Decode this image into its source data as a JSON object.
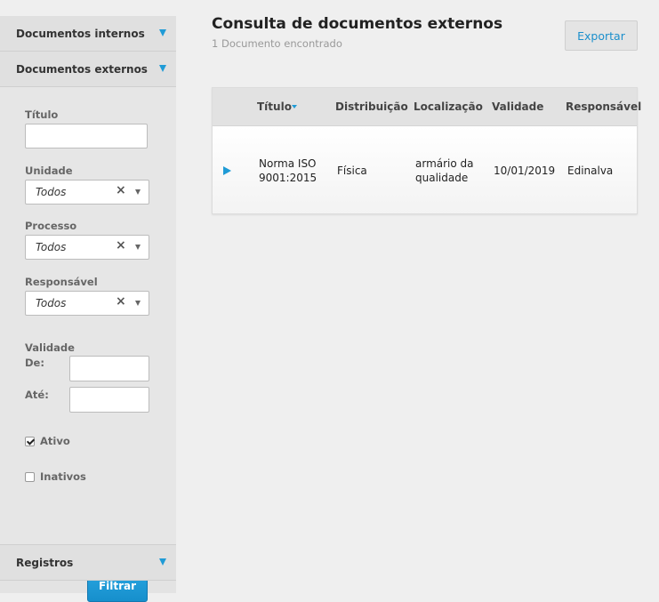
{
  "sidebar": {
    "internos_label": "Documentos internos",
    "externos_label": "Documentos externos",
    "registros_label": "Registros",
    "filters": {
      "titulo_label": "Título",
      "titulo_value": "",
      "unidade_label": "Unidade",
      "unidade_value": "Todos",
      "processo_label": "Processo",
      "processo_value": "Todos",
      "responsavel_label": "Responsável",
      "responsavel_value": "Todos",
      "validade_label": "Validade",
      "de_label": "De:",
      "ate_label": "Até:",
      "ativo_label": "Ativo",
      "inativos_label": "Inativos",
      "filtrar_label": "Filtrar"
    }
  },
  "main": {
    "title": "Consulta de documentos externos",
    "subtitle": "1 Documento encontrado",
    "export_label": "Exportar",
    "columns": [
      "Título",
      "Distribuição",
      "Localização",
      "Validade",
      "Responsável"
    ],
    "rows": [
      {
        "titulo": "Norma ISO 9001:2015",
        "distribuicao": "Física",
        "localizacao": "armário da qualidade",
        "validade": "10/01/2019",
        "responsavel": "Edinalva"
      }
    ]
  },
  "colors": {
    "accent": "#1f9bd6",
    "button_primary": "#1f9bd6",
    "background": "#efefef",
    "sidebar": "#e3e3e3"
  },
  "icons": {
    "accordion_caret": "caret-down-icon",
    "clear": "clear-x-icon",
    "dropdown": "dropdown-arrow-icon",
    "expand_row": "expand-row-icon",
    "sort": "sort-desc-icon"
  }
}
